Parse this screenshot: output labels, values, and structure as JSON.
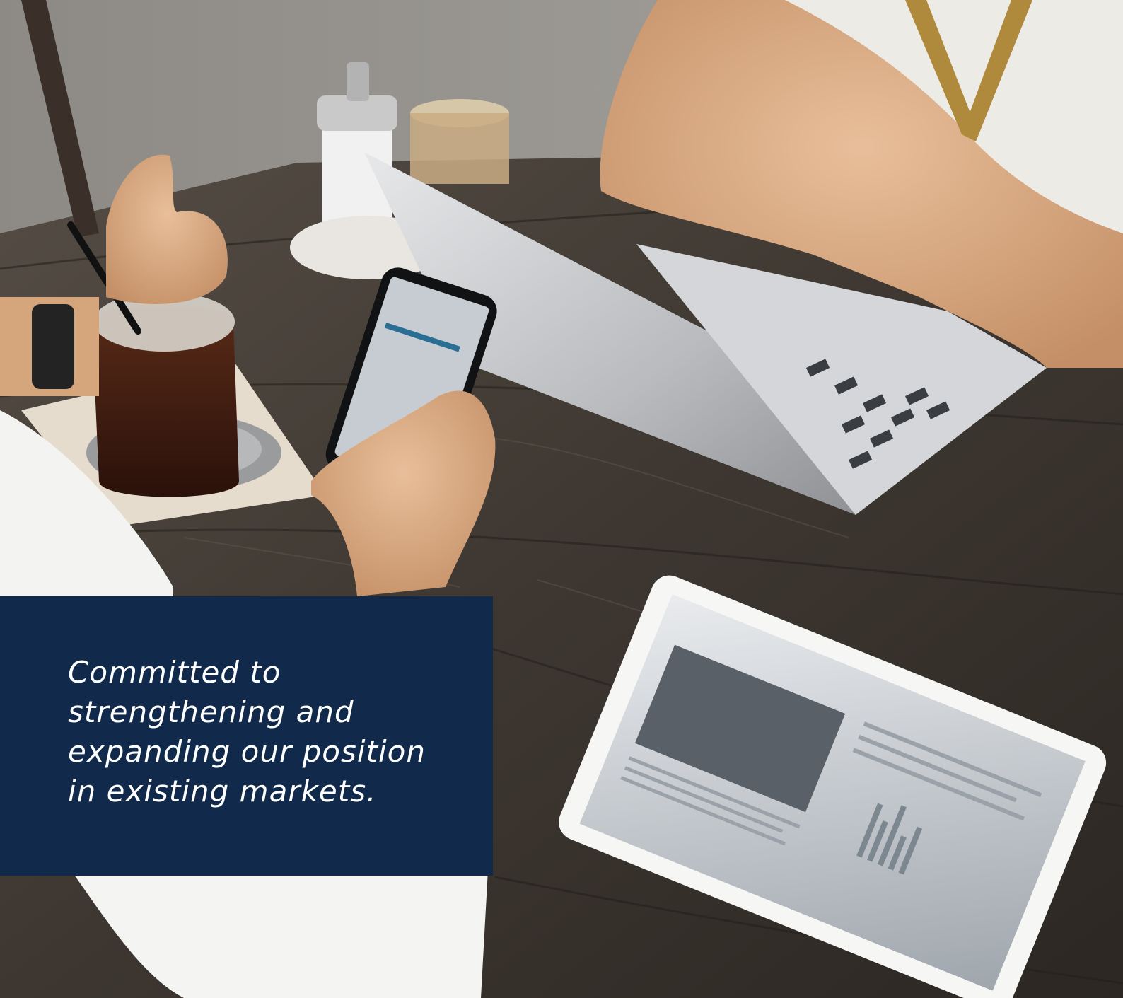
{
  "quote": {
    "text": "Committed to strengthening and expanding our position in existing markets."
  },
  "colors": {
    "panel": "#112a4b",
    "table_wood": "#3d3731",
    "text": "#ffffff"
  }
}
